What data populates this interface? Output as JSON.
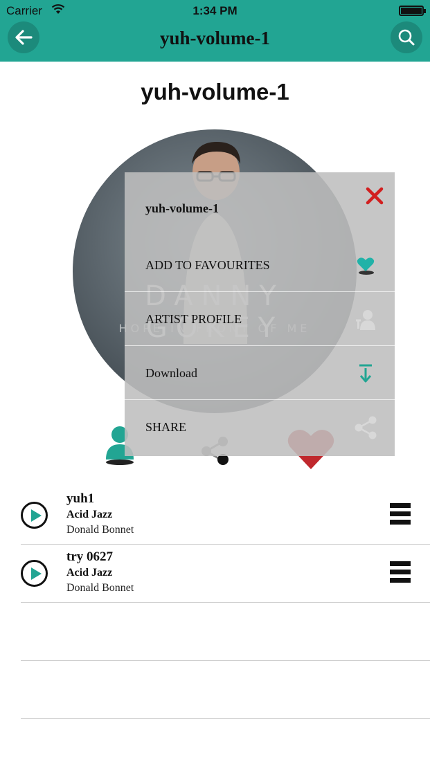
{
  "status_bar": {
    "carrier": "Carrier",
    "time": "1:34 PM"
  },
  "nav": {
    "title": "yuh-volume-1",
    "back_icon": "back-arrow-icon",
    "search_icon": "search-icon"
  },
  "album": {
    "title": "yuh-volume-1",
    "artwork_text_main": "DANNY GOKEY",
    "artwork_text_sub": "HOPE IN FRONT OF ME"
  },
  "menu": {
    "title": "yuh-volume-1",
    "items": [
      {
        "label": "ADD TO FAVOURITES",
        "icon": "heart-icon"
      },
      {
        "label": "ARTIST PROFILE",
        "icon": "artist-icon"
      },
      {
        "label": "Download",
        "icon": "download-icon"
      },
      {
        "label": "SHARE",
        "icon": "share-icon"
      }
    ]
  },
  "tracks": [
    {
      "name": "yuh1",
      "genre": "Acid Jazz",
      "artist": "Donald Bonnet"
    },
    {
      "name": "try 0627",
      "genre": "Acid Jazz",
      "artist": "Donald Bonnet"
    }
  ],
  "colors": {
    "accent": "#22a593",
    "close": "#d21f1f",
    "heart": "#c0282d"
  }
}
